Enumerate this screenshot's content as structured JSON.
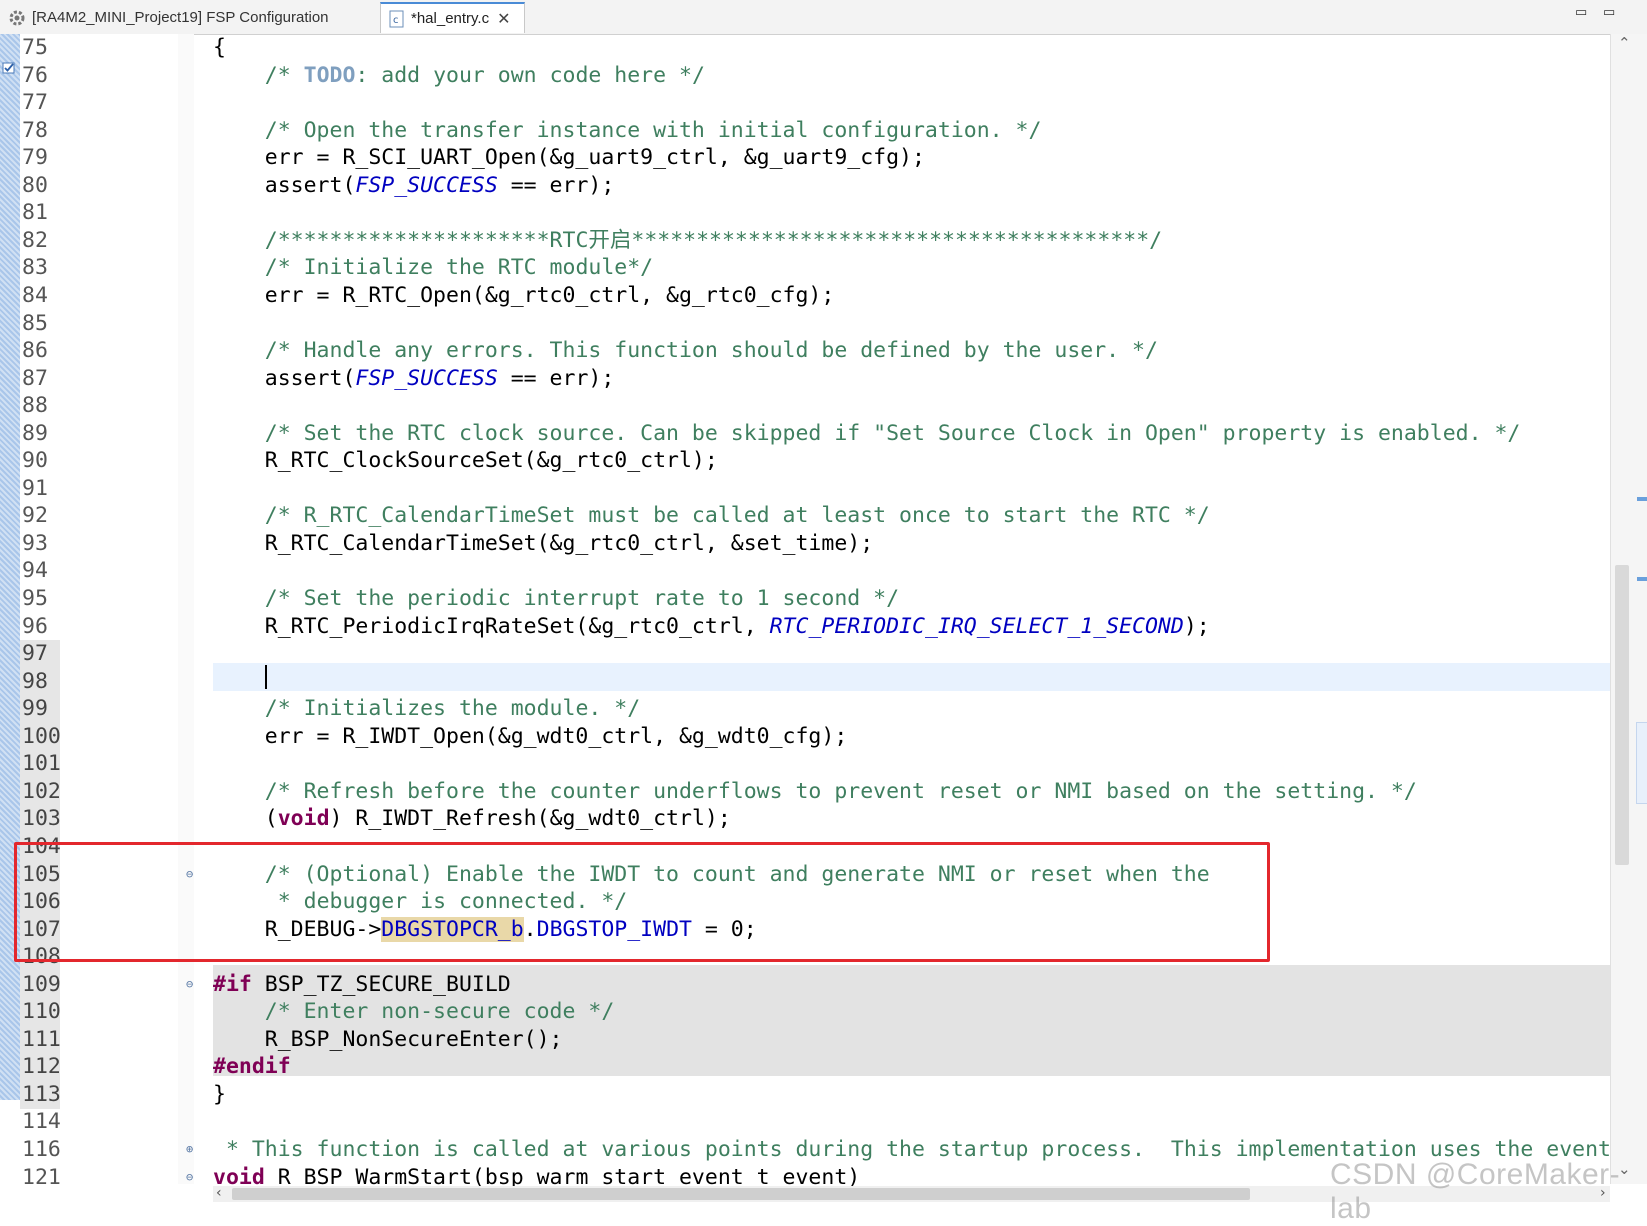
{
  "tabs": [
    {
      "label": "[RA4M2_MINI_Project19] FSP Configuration",
      "icon": "gear-icon",
      "active": false
    },
    {
      "label": "*hal_entry.c",
      "icon": "c-file-icon",
      "active": true,
      "close": "✕"
    }
  ],
  "window_controls": {
    "minimize": "▭",
    "maximize": "▭"
  },
  "lines": [
    {
      "num": "75",
      "parts": [
        {
          "t": "{"
        }
      ]
    },
    {
      "num": "76",
      "parts": [
        {
          "t": "    "
        },
        {
          "t": "/* ",
          "c": "cm"
        },
        {
          "t": "TODO",
          "c": "todo"
        },
        {
          "t": ": add your own code here */",
          "c": "cm"
        }
      ]
    },
    {
      "num": "77",
      "parts": []
    },
    {
      "num": "78",
      "parts": [
        {
          "t": "    "
        },
        {
          "t": "/* Open the transfer instance with initial configuration. */",
          "c": "cm"
        }
      ]
    },
    {
      "num": "79",
      "parts": [
        {
          "t": "    err = R_SCI_UART_Open(&g_uart9_ctrl, &g_uart9_cfg);"
        }
      ]
    },
    {
      "num": "80",
      "parts": [
        {
          "t": "    assert("
        },
        {
          "t": "FSP_SUCCESS",
          "c": "cn"
        },
        {
          "t": " == err);"
        }
      ]
    },
    {
      "num": "81",
      "parts": []
    },
    {
      "num": "82",
      "parts": [
        {
          "t": "    "
        },
        {
          "t": "/*********************RTC开启****************************************/",
          "c": "cm"
        }
      ]
    },
    {
      "num": "83",
      "parts": [
        {
          "t": "    "
        },
        {
          "t": "/* Initialize the RTC module*/",
          "c": "cm"
        }
      ]
    },
    {
      "num": "84",
      "parts": [
        {
          "t": "    err = R_RTC_Open(&g_rtc0_ctrl, &g_rtc0_cfg);"
        }
      ]
    },
    {
      "num": "85",
      "parts": []
    },
    {
      "num": "86",
      "parts": [
        {
          "t": "    "
        },
        {
          "t": "/* Handle any errors. This function should be defined by the user. */",
          "c": "cm"
        }
      ]
    },
    {
      "num": "87",
      "parts": [
        {
          "t": "    assert("
        },
        {
          "t": "FSP_SUCCESS",
          "c": "cn"
        },
        {
          "t": " == err);"
        }
      ]
    },
    {
      "num": "88",
      "parts": []
    },
    {
      "num": "89",
      "parts": [
        {
          "t": "    "
        },
        {
          "t": "/* Set the RTC clock source. Can be skipped if \"Set Source Clock in Open\" property is enabled. */",
          "c": "cm"
        }
      ]
    },
    {
      "num": "90",
      "parts": [
        {
          "t": "    R_RTC_ClockSourceSet(&g_rtc0_ctrl);"
        }
      ]
    },
    {
      "num": "91",
      "parts": []
    },
    {
      "num": "92",
      "parts": [
        {
          "t": "    "
        },
        {
          "t": "/* R_RTC_CalendarTimeSet must be called at least once to start the RTC */",
          "c": "cm"
        }
      ]
    },
    {
      "num": "93",
      "parts": [
        {
          "t": "    R_RTC_CalendarTimeSet(&g_rtc0_ctrl, &set_time);"
        }
      ]
    },
    {
      "num": "94",
      "parts": []
    },
    {
      "num": "95",
      "parts": [
        {
          "t": "    "
        },
        {
          "t": "/* Set the periodic interrupt rate to 1 second */",
          "c": "cm"
        }
      ]
    },
    {
      "num": "96",
      "parts": [
        {
          "t": "    R_RTC_PeriodicIrqRateSet(&g_rtc0_ctrl, "
        },
        {
          "t": "RTC_PERIODIC_IRQ_SELECT_1_SECOND",
          "c": "cn"
        },
        {
          "t": ");"
        }
      ]
    },
    {
      "num": "97",
      "parts": [],
      "sel": true
    },
    {
      "num": "98",
      "parts": [],
      "sel": true,
      "current": true
    },
    {
      "num": "99",
      "parts": [
        {
          "t": "    "
        },
        {
          "t": "/* Initializes the module. */",
          "c": "cm"
        }
      ],
      "sel": true
    },
    {
      "num": "100",
      "parts": [
        {
          "t": "    err = R_IWDT_Open(&g_wdt0_ctrl, &g_wdt0_cfg);"
        }
      ],
      "sel": true
    },
    {
      "num": "101",
      "parts": [],
      "sel": true
    },
    {
      "num": "102",
      "parts": [
        {
          "t": "    "
        },
        {
          "t": "/* Refresh before the counter underflows to prevent reset or NMI based on the setting. */",
          "c": "cm"
        }
      ],
      "sel": true
    },
    {
      "num": "103",
      "parts": [
        {
          "t": "    ("
        },
        {
          "t": "void",
          "c": "kw"
        },
        {
          "t": ") R_IWDT_Refresh(&g_wdt0_ctrl);"
        }
      ],
      "sel": true
    },
    {
      "num": "104",
      "parts": [],
      "sel": true
    },
    {
      "num": "105",
      "parts": [
        {
          "t": "    "
        },
        {
          "t": "/* (Optional) Enable the IWDT to count and generate NMI or reset when the",
          "c": "cm"
        }
      ],
      "sel": true,
      "fold": "⊖"
    },
    {
      "num": "106",
      "parts": [
        {
          "t": "     "
        },
        {
          "t": "* debugger is connected. */",
          "c": "cm"
        }
      ],
      "sel": true
    },
    {
      "num": "107",
      "parts": [
        {
          "t": "    R_DEBUG->"
        },
        {
          "t": "DBGSTOPCR_b",
          "c": "field hl"
        },
        {
          "t": "."
        },
        {
          "t": "DBGSTOP_IWDT",
          "c": "field"
        },
        {
          "t": " = 0;"
        }
      ],
      "sel": true
    },
    {
      "num": "108",
      "parts": [],
      "sel": true
    },
    {
      "num": "109",
      "parts": [
        {
          "t": "#if",
          "c": "kw"
        },
        {
          "t": " BSP_TZ_SECURE_BUILD"
        }
      ],
      "sel": true,
      "fold": "⊖"
    },
    {
      "num": "110",
      "parts": [
        {
          "t": "    "
        },
        {
          "t": "/* Enter non-secure code */",
          "c": "cm"
        }
      ],
      "sel": true
    },
    {
      "num": "111",
      "parts": [
        {
          "t": "    R_BSP_NonSecureEnter();"
        }
      ],
      "sel": true
    },
    {
      "num": "112",
      "parts": [
        {
          "t": "#endif",
          "c": "kw"
        }
      ],
      "sel": true
    },
    {
      "num": "113",
      "parts": [
        {
          "t": "}"
        }
      ],
      "sel": true
    },
    {
      "num": "114",
      "parts": []
    },
    {
      "num": "116",
      "parts": [
        {
          "t": " "
        },
        {
          "t": "* This function is called at various points during the startup process.  This implementation uses the event",
          "c": "cm"
        }
      ],
      "fold": "⊕"
    },
    {
      "num": "121",
      "parts": [
        {
          "t": "void",
          "c": "kw"
        },
        {
          "t": " R_BSP_WarmStart(bsp_warm_start_event_t event)"
        }
      ],
      "fold": "⊖"
    }
  ],
  "scrollbar": {
    "up": "⌃",
    "down": "⌄",
    "left": "‹",
    "right": "›"
  },
  "watermark": "CSDN @CoreMaker-lab",
  "colors": {
    "comment": "#3f7f5f",
    "constant": "#0000c0",
    "keyword": "#7f0055",
    "todo": "#7f9fbf",
    "highlight_box": "#e3272d",
    "current_line": "#e8f2fe",
    "inactive_code": "#e3e3e3"
  }
}
